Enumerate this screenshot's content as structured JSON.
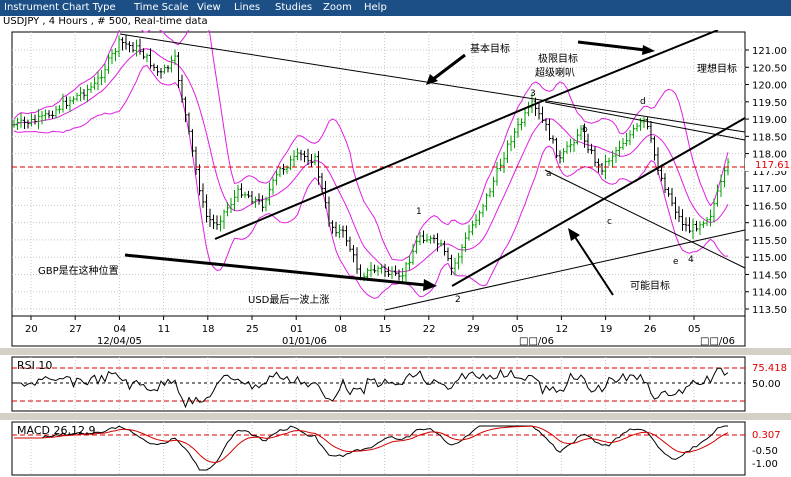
{
  "menu": {
    "items": [
      "Instrument",
      "Chart Type",
      "Time Scale",
      "View",
      "Lines",
      "Studies",
      "Zoom",
      "Help"
    ]
  },
  "chart_title": "USDJPY , 4 Hours , # 500, Real-time data",
  "colors": {
    "menubar_bg": "#1c4f86",
    "up_bar": "#00a000",
    "down_bar": "#000000",
    "bollinger": "#e020e0",
    "reference_line": "#e00000",
    "rsi_line": "#000000",
    "macd_signal": "#d00000"
  },
  "price_axis": {
    "ticks": [
      "121.00",
      "120.50",
      "120.00",
      "119.50",
      "119.00",
      "118.50",
      "118.00",
      "117.50",
      "117.00",
      "116.50",
      "116.00",
      "115.50",
      "115.00",
      "114.50",
      "114.00",
      "113.50"
    ],
    "current_price": "117.61"
  },
  "date_axis": {
    "day_ticks": [
      "20",
      "27",
      "04",
      "11",
      "18",
      "25",
      "01",
      "08",
      "15",
      "22",
      "29",
      "05",
      "12",
      "19",
      "26",
      "05"
    ],
    "month_labels": [
      "12/04/05",
      "01/01/06",
      "□□/06",
      "□□/06"
    ]
  },
  "annotations": {
    "basic_target": "基本目标",
    "extreme_target": "极限目标",
    "overshoot": "超级喇叭",
    "ideal_target": "理想目标",
    "gbp_position": "GBP是在这种位置",
    "usd_last_wave": "USD最后一波上涨",
    "possible_target": "可能目标",
    "wave_labels": [
      "1",
      "2",
      "3",
      "4",
      "a",
      "b",
      "c",
      "d",
      "e"
    ]
  },
  "rsi": {
    "label": "RSI 10",
    "value": "75.418",
    "level": "50.00"
  },
  "macd": {
    "label": "MACD 26,12,9",
    "value": "0.307",
    "levels": [
      "-0.50",
      "-1.00"
    ]
  }
}
